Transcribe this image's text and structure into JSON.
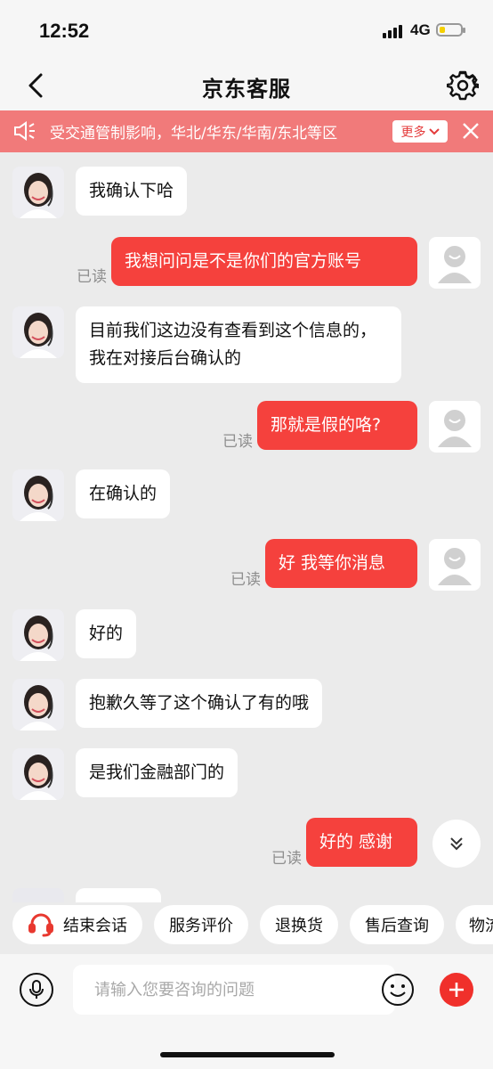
{
  "status": {
    "time": "12:52",
    "network": "4G",
    "battery_level": 0.25
  },
  "nav": {
    "title": "京东客服",
    "back_icon": "chevron-left-icon",
    "settings_icon": "gear-icon"
  },
  "notice": {
    "text": "受交通管制影响，华北/华东/华南/东北等区",
    "more_label": "更多"
  },
  "read_label": "已读",
  "messages": [
    {
      "from": "agent",
      "text": "我确认下哈"
    },
    {
      "from": "user",
      "text": "我想问问是不是你们的官方账号",
      "status": "已读"
    },
    {
      "from": "agent",
      "text": "目前我们这边没有查看到这个信息的，我在对接后台确认的"
    },
    {
      "from": "user",
      "text": "那就是假的咯?",
      "status": "已读"
    },
    {
      "from": "agent",
      "text": "在确认的"
    },
    {
      "from": "user",
      "text": "好 我等你消息",
      "status": "已读"
    },
    {
      "from": "agent",
      "text": "好的"
    },
    {
      "from": "agent",
      "text": "抱歉久等了这个确认了有的哦"
    },
    {
      "from": "agent",
      "text": "是我们金融部门的"
    },
    {
      "from": "user",
      "text": "好的 感谢",
      "status": "已读"
    }
  ],
  "quick_actions": [
    {
      "label": "结束会话",
      "icon": "headset-icon"
    },
    {
      "label": "服务评价"
    },
    {
      "label": "退换货"
    },
    {
      "label": "售后查询"
    },
    {
      "label": "物流"
    }
  ],
  "input": {
    "placeholder": "请输入您要咨询的问题",
    "value": ""
  },
  "colors": {
    "brand_red": "#f5413d",
    "notice_bg": "#f17a7a",
    "chat_bg": "#ebebeb"
  }
}
